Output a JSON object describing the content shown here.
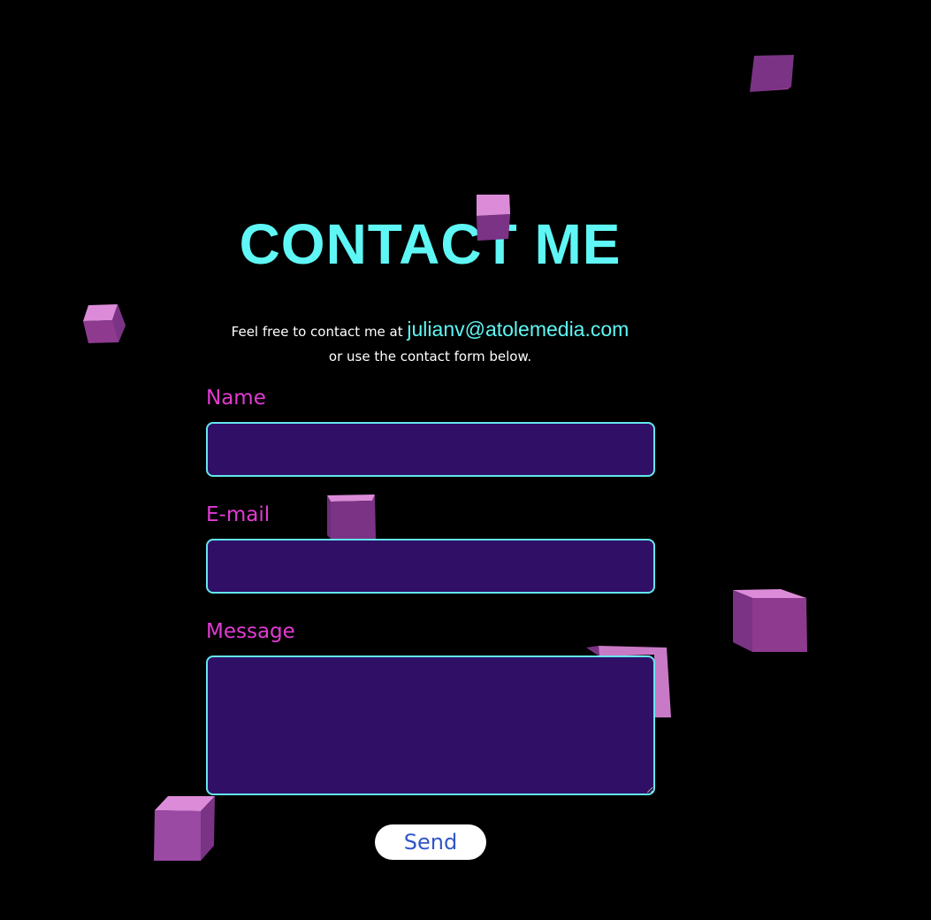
{
  "colors": {
    "background": "#000000",
    "title": "#5ff7f5",
    "label": "#e23bd3",
    "field_bg": "#2f1066",
    "field_border": "#63e8ee",
    "send_text": "#2f57c7",
    "cube_top": "#dc8bd9",
    "cube_side": "#7a3385",
    "cube_front": "#8d3a8f"
  },
  "page": {
    "title": "CONTACT ME",
    "intro_prefix": "Feel free to contact me at ",
    "email": "julianv@atolemedia.com",
    "intro_suffix": "or use the contact form below."
  },
  "form": {
    "name_label": "Name",
    "name_value": "",
    "email_label": "E-mail",
    "email_value": "",
    "message_label": "Message",
    "message_value": "",
    "send_label": "Send"
  },
  "decorations": {
    "cube_icon": "cube-icon"
  }
}
